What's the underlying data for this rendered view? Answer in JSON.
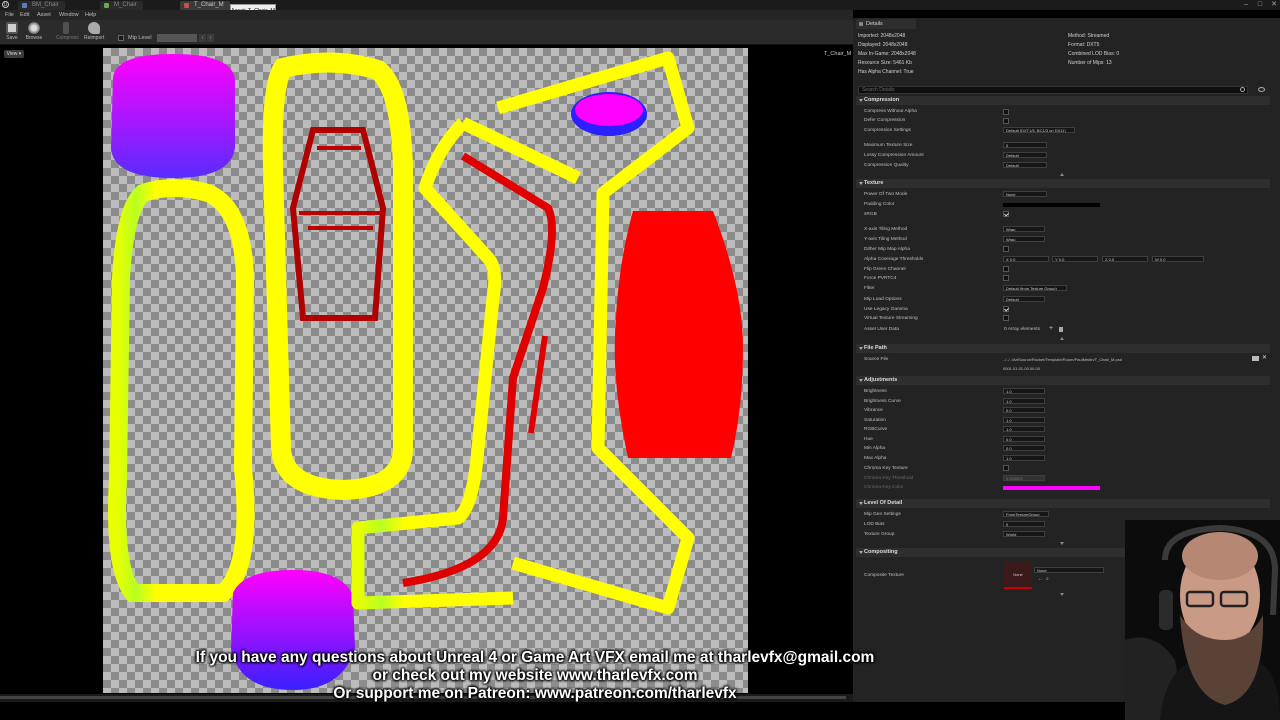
{
  "window": {
    "tabs": [
      "BM_Chair",
      "M_Chair",
      "T_Chair_M"
    ],
    "tooltip": "Asset: T_Chair_M",
    "controls": {
      "minimize": "–",
      "maximize": "□",
      "close": "✕"
    }
  },
  "menu": [
    "File",
    "Edit",
    "Asset",
    "Window",
    "Help"
  ],
  "toolbar": {
    "buttons": [
      {
        "label": "Save",
        "icon": "save-icon"
      },
      {
        "label": "Browse",
        "icon": "browse-icon"
      },
      {
        "label": "Compress",
        "icon": "compress-icon"
      },
      {
        "label": "Reimport",
        "icon": "reimport-icon"
      }
    ],
    "mip_label": "Mip Level"
  },
  "viewport": {
    "view_button": "View",
    "asset_name": "T_Chair_M"
  },
  "overlay": {
    "line1": "If you have any questions about Unreal 4 or Game Art VFX email me at tharlevfx@gmail.com",
    "line2": "or check out my website www.tharlevfx.com",
    "line3": "Or support me on Patreon: www.patreon.com/tharlevfx"
  },
  "details": {
    "tab_label": "Details",
    "info_left": [
      "Imported: 2048x2048",
      "Displayed: 2048x2048",
      "Max In-Game: 2048x2048",
      "Resource Size: 5461 Kb",
      "Has Alpha Channel: True"
    ],
    "info_right": [
      "Method: Streamed",
      "Format: DXT5",
      "Combined LOD Bias: 0",
      "Number of Mips: 13"
    ],
    "search_placeholder": "Search Details",
    "sections": {
      "compression": {
        "title": "Compression",
        "rows": [
          "Compress Without Alpha",
          "Defer Compression",
          "Compression Settings",
          "Maximum Texture Size",
          "Lossy Compression Amount",
          "Compression Quality"
        ],
        "values": {
          "settings": "Default (DXT1/5, BC1/3 on DX11)",
          "max_size": "0",
          "lossy": "Default",
          "quality": "Default"
        }
      },
      "texture": {
        "title": "Texture",
        "rows": [
          "Power Of Two Mode",
          "Padding Color",
          "sRGB",
          "X-axis Tiling Method",
          "Y-axis Tiling Method",
          "Dither Mip Map Alpha",
          "Alpha Coverage Thresholds",
          "Flip Green Channel",
          "Force PVRTC4",
          "Filter",
          "Mip Load Options",
          "Use Legacy Gamma",
          "Virtual Texture Streaming",
          "Asset User Data"
        ],
        "values": {
          "pot": "None",
          "x_tiling": "Wrap",
          "y_tiling": "Wrap",
          "x": "X",
          "y": "Y",
          "z": "Z",
          "w": "W",
          "zero": "0.0",
          "filter": "Default (from Texture Group)",
          "mip_load": "Default",
          "user_data": "0 Array elements"
        },
        "colors": {
          "padding": "#000000"
        }
      },
      "file_path": {
        "title": "File Path",
        "rows": [
          "Source File"
        ],
        "values": {
          "source": "../../../ArtSource/Rocket/Template/Room/PaulMedin/T_Chair_M.psd",
          "timestamp": "0001.01.01-00.00.00"
        }
      },
      "adjustments": {
        "title": "Adjustments",
        "rows": [
          "Brightness",
          "Brightness Curve",
          "Vibrance",
          "Saturation",
          "RGBCurve",
          "Hue",
          "Min Alpha",
          "Max Alpha",
          "Chroma Key Texture",
          "Chroma Key Threshold",
          "Chroma Key Color"
        ],
        "values": [
          "1.0",
          "1.0",
          "0.0",
          "1.0",
          "1.0",
          "0.0",
          "0.0",
          "1.0"
        ],
        "chroma_threshold": "0.003922",
        "colors": {
          "chroma_key": "#ff00ff"
        }
      },
      "lod": {
        "title": "Level Of Detail",
        "rows": [
          "Mip Gen Settings",
          "LOD Bias",
          "Texture Group"
        ],
        "values": {
          "mip_gen": "FromTextureGroup",
          "lod_bias": "0",
          "group": "World"
        }
      },
      "compositing": {
        "title": "Compositing",
        "rows": [
          "Composite Texture"
        ],
        "values": {
          "thumb": "None",
          "combo": "None"
        }
      }
    }
  }
}
